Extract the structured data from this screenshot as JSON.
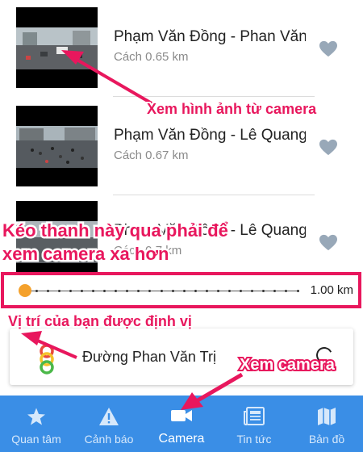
{
  "cameras": [
    {
      "title": "Phạm Văn Đồng - Phan Văn",
      "distance": "Cách 0.65 km"
    },
    {
      "title": "Phạm Văn Đồng - Lê Quang",
      "distance": "Cách 0.67 km"
    },
    {
      "title": "Phạm Văn Đồng - Lê Quang",
      "distance": "Cách 0.7 km"
    }
  ],
  "slider": {
    "value_label": "1.00 km",
    "position": 0.0
  },
  "location": {
    "text": "Đường Phan Văn Trị"
  },
  "nav": [
    {
      "label": "Quan tâm",
      "icon": "star-icon"
    },
    {
      "label": "Cảnh báo",
      "icon": "warning-icon"
    },
    {
      "label": "Camera",
      "icon": "camera-icon",
      "active": true
    },
    {
      "label": "Tin tức",
      "icon": "newspaper-icon"
    },
    {
      "label": "Bản đồ",
      "icon": "map-icon"
    }
  ],
  "annotations": {
    "view_camera_image": "Xem hình ảnh từ camera",
    "drag_line1": "Kéo thanh này qua phải để",
    "drag_line2": "xem camera xa hơn",
    "your_location": "Vị trí của bạn được định vị",
    "view_camera": "Xem camera"
  },
  "colors": {
    "accent": "#e8175d",
    "nav_bg": "#3a8ee6",
    "knob": "#f4a12c",
    "heart": "#98a8b8"
  }
}
